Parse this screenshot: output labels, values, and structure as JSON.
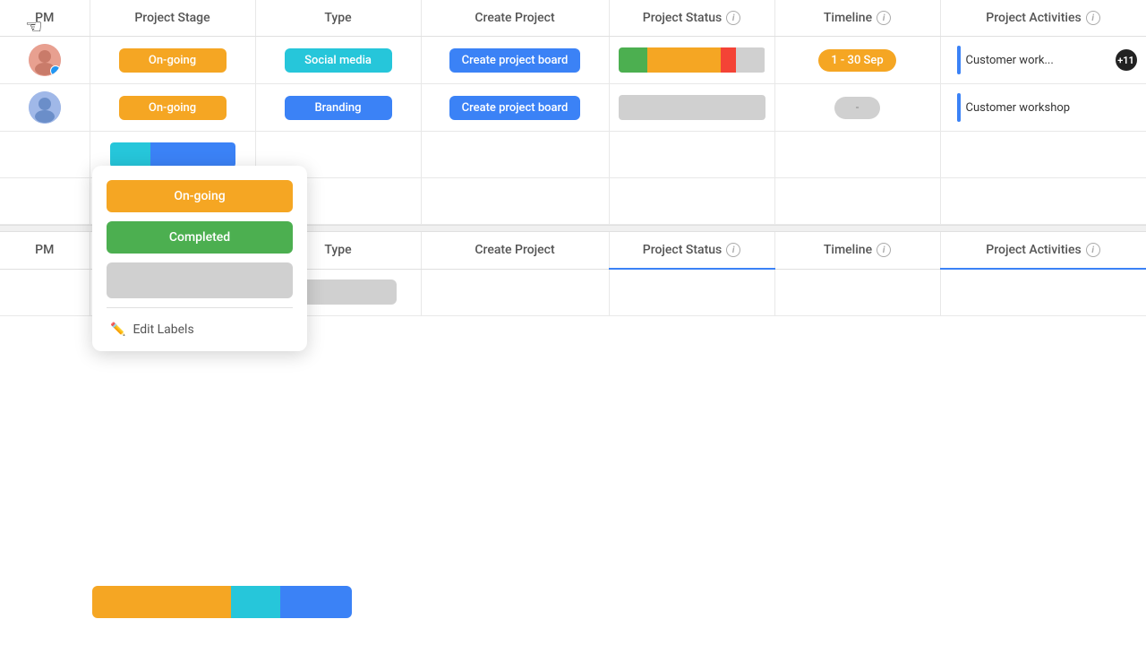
{
  "cursor": "☜",
  "colors": {
    "ongoing": "#F5A623",
    "completed": "#4CAF50",
    "branding": "#3B82F6",
    "social": "#26C6DA",
    "gray": "#d0d0d0"
  },
  "header": {
    "pm": "PM",
    "project_stage": "Project Stage",
    "type": "Type",
    "create_project": "Create Project",
    "project_status": "Project Status",
    "timeline": "Timeline",
    "project_activities": "Project Activities"
  },
  "rows": [
    {
      "stage": "On-going",
      "type": "Social media",
      "create_btn": "Create project board",
      "timeline": "1 - 30 Sep",
      "activity_text": "Customer work...",
      "activity_count": "+11"
    },
    {
      "stage": "On-going",
      "type": "Branding",
      "create_btn": "Create project board",
      "timeline": "-",
      "activity_text": "Customer workshop",
      "activity_count": ""
    }
  ],
  "dropdown": {
    "option1": "On-going",
    "option2": "Completed",
    "edit_labels": "Edit Labels"
  },
  "bottom_header": {
    "pm": "PM",
    "type": "Type",
    "create_project": "Create Project",
    "project_status": "Project Status",
    "timeline": "Timeline",
    "project_activities": "Project Activities"
  }
}
